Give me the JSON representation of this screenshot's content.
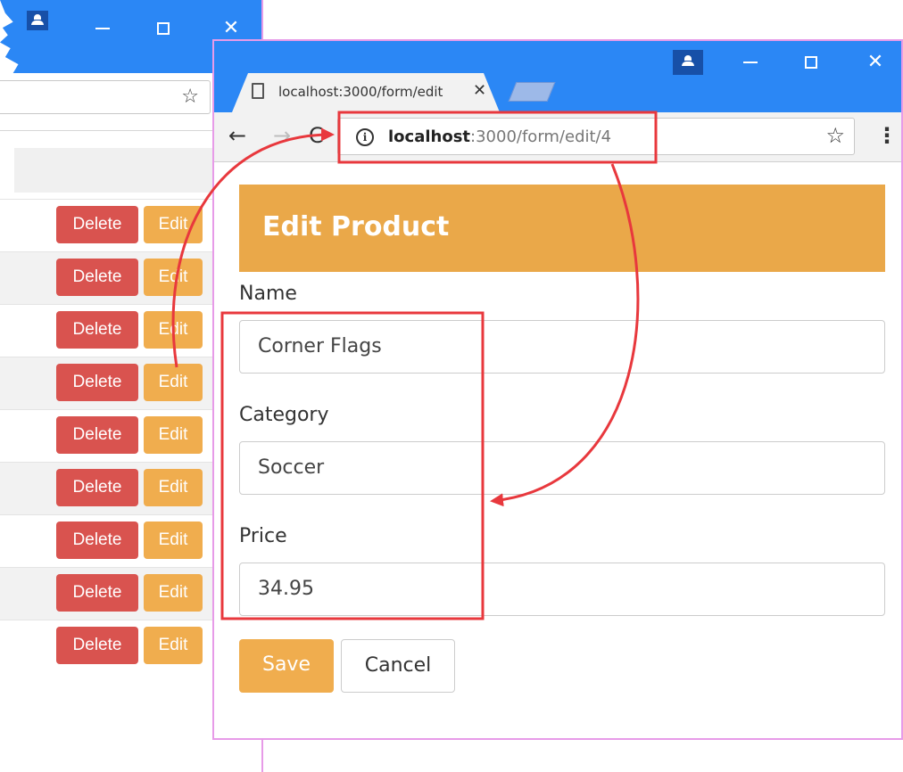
{
  "back_window": {
    "controls": {
      "minimize": "—",
      "maximize": "☐",
      "close": "✕"
    },
    "star_icon": "☆",
    "rows": [
      {
        "delete_label": "Delete",
        "edit_label": "Edit"
      },
      {
        "delete_label": "Delete",
        "edit_label": "Edit"
      },
      {
        "delete_label": "Delete",
        "edit_label": "Edit"
      },
      {
        "delete_label": "Delete",
        "edit_label": "Edit"
      },
      {
        "delete_label": "Delete",
        "edit_label": "Edit"
      },
      {
        "delete_label": "Delete",
        "edit_label": "Edit"
      },
      {
        "delete_label": "Delete",
        "edit_label": "Edit"
      },
      {
        "delete_label": "Delete",
        "edit_label": "Edit"
      },
      {
        "delete_label": "Delete",
        "edit_label": "Edit"
      }
    ]
  },
  "front_window": {
    "tab": {
      "title": "localhost:3000/form/edit",
      "title_fade": "/",
      "close_icon": "✕"
    },
    "toolbar": {
      "back_icon": "←",
      "forward_icon": "→",
      "reload_icon": "C",
      "info_icon": "i",
      "url_host": "localhost",
      "url_rest": ":3000/form/edit/4",
      "star_icon": "☆",
      "menu_icon": "⋮"
    },
    "form": {
      "heading": "Edit Product",
      "fields": [
        {
          "label": "Name",
          "value": "Corner Flags"
        },
        {
          "label": "Category",
          "value": "Soccer"
        },
        {
          "label": "Price",
          "value": "34.95"
        }
      ],
      "save_label": "Save",
      "cancel_label": "Cancel"
    }
  },
  "colors": {
    "titlebar": "#2b87f5",
    "danger": "#d9534f",
    "warning": "#f0ad4e",
    "heading": "#eaa849",
    "annotation": "#e8383d"
  }
}
